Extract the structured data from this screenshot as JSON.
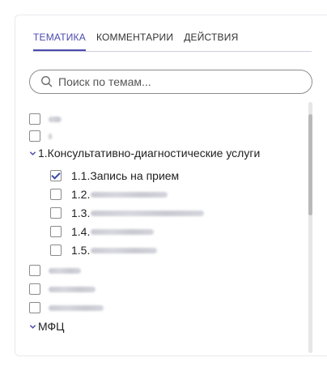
{
  "tabs": [
    {
      "label": "ТЕМАТИКА",
      "active": true
    },
    {
      "label": "КОММЕНТАРИИ",
      "active": false
    },
    {
      "label": "ДЕЙСТВИЯ",
      "active": false
    }
  ],
  "search": {
    "placeholder": "Поиск по темам...",
    "value": ""
  },
  "tree": {
    "group1": {
      "label": "1.Консультативно-диагностические услуги",
      "expanded": true
    },
    "child1": {
      "label": "1.1.Запись на прием",
      "checked": true
    },
    "child2": {
      "prefix": "1.2."
    },
    "child3": {
      "prefix": "1.3."
    },
    "child4": {
      "prefix": "1.4."
    },
    "child5": {
      "prefix": "1.5."
    },
    "group2": {
      "label": "МФЦ",
      "expanded": true
    }
  },
  "colors": {
    "accent": "#4a4ab0",
    "check": "#3b4aa8"
  }
}
